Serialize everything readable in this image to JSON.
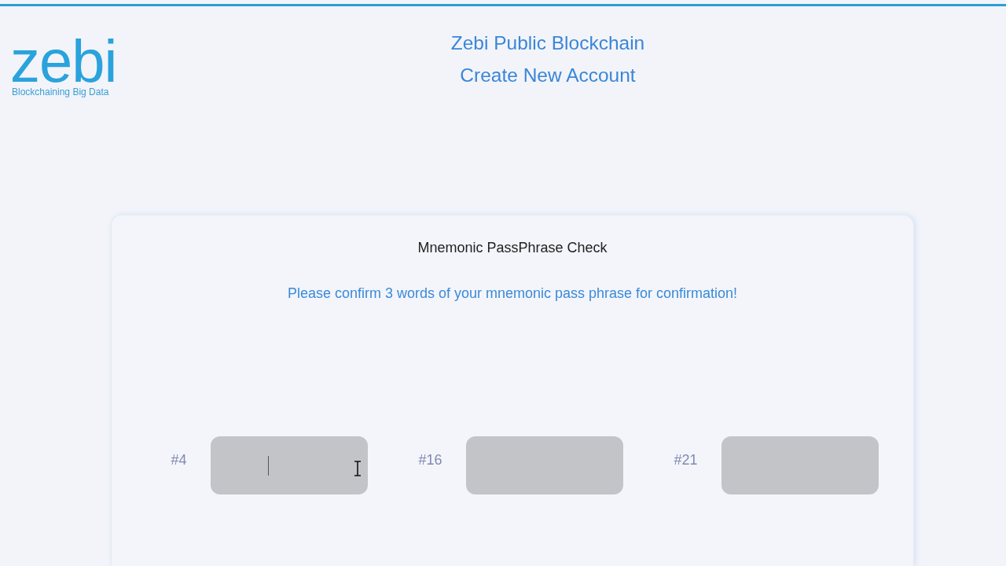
{
  "logo": {
    "wordmark": "zebi",
    "tagline": "Blockchaining Big Data"
  },
  "header": {
    "title": "Zebi Public Blockchain",
    "subtitle": "Create New Account"
  },
  "card": {
    "title": "Mnemonic PassPhrase Check",
    "instruction": "Please confirm 3 words of your mnemonic pass phrase for confirmation!",
    "word_fields": [
      {
        "label": "#4",
        "focused": true,
        "hovered": true
      },
      {
        "label": "#16",
        "focused": false,
        "hovered": false
      },
      {
        "label": "#21",
        "focused": false,
        "hovered": false
      }
    ]
  }
}
